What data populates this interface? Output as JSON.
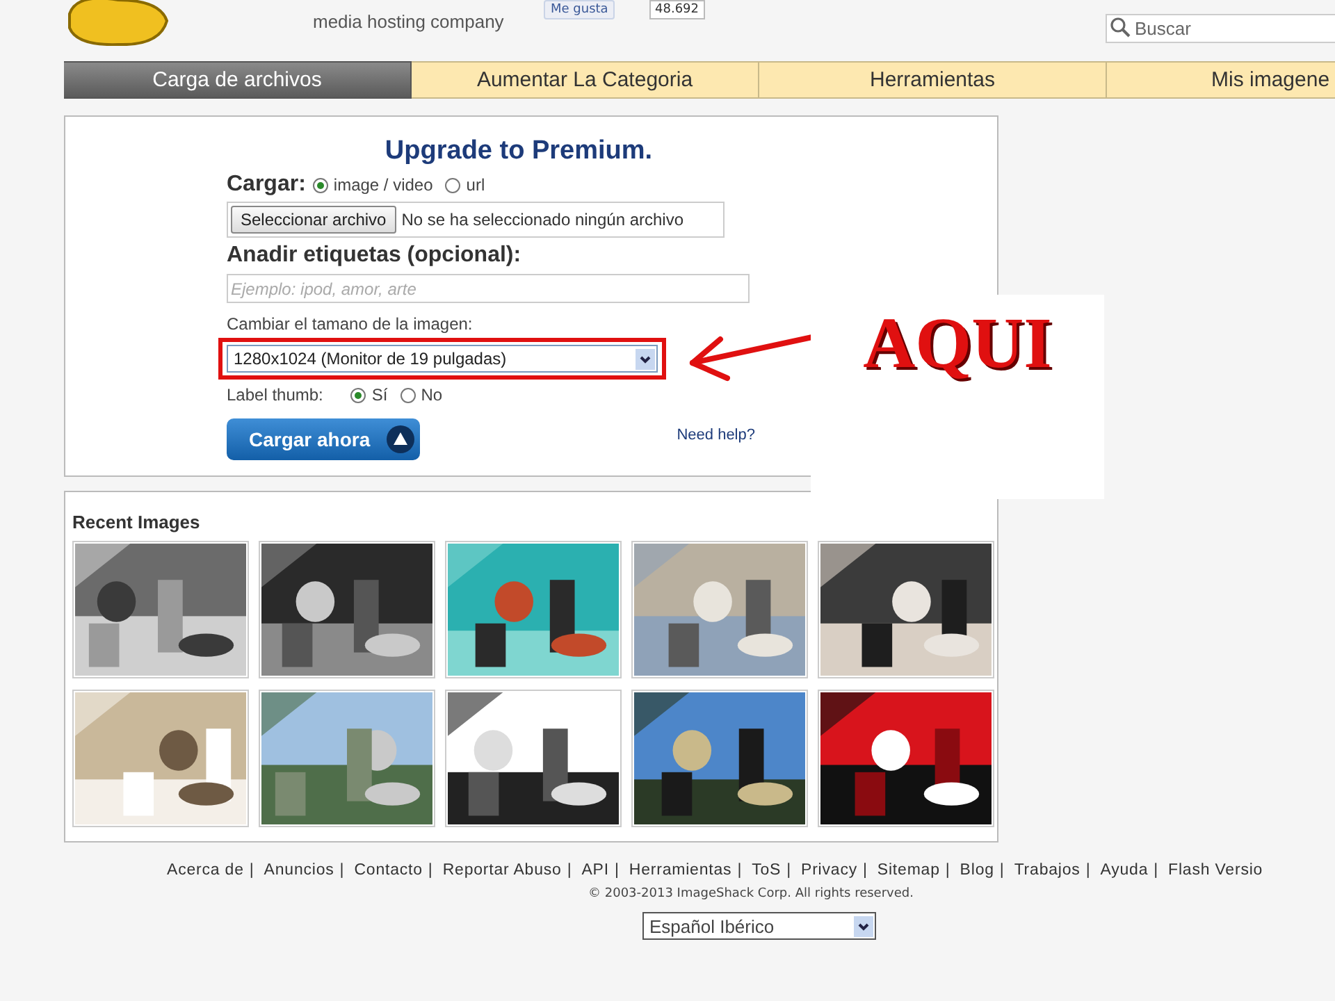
{
  "header": {
    "tagline": "media hosting company",
    "like_button": "Me gusta",
    "like_count": "48.692",
    "search": {
      "placeholder": "Buscar"
    }
  },
  "tabs": [
    {
      "label": "Carga de archivos",
      "selected": true
    },
    {
      "label": "Aumentar La Categoria",
      "selected": false
    },
    {
      "label": "Herramientas",
      "selected": false
    },
    {
      "label": "Mis imagene",
      "selected": false
    }
  ],
  "upload_form": {
    "title": "Upgrade to Premium.",
    "source_label": "Cargar:",
    "source_options": [
      {
        "label": "image / video",
        "selected": true
      },
      {
        "label": "url",
        "selected": false
      }
    ],
    "file_button": "Seleccionar archivo",
    "file_status": "No se ha seleccionado ningún archivo",
    "tags_label": "Anadir etiquetas (opcional):",
    "tags_placeholder": "Ejemplo: ipod, amor, arte",
    "resize_label": "Cambiar el tamano de la imagen:",
    "resize_value": "1280x1024 (Monitor de 19 pulgadas)",
    "thumb_label": "Label thumb:",
    "thumb_options": [
      {
        "label": "Sí",
        "selected": true
      },
      {
        "label": "No",
        "selected": false
      }
    ],
    "submit_button": "Cargar ahora",
    "help_link": "Need help?"
  },
  "annotation": {
    "text": "AQUI"
  },
  "recent_images": {
    "title": "Recent Images"
  },
  "footer": {
    "links": [
      "Acerca de",
      "Anuncios",
      "Contacto",
      "Reportar Abuso",
      "API",
      "Herramientas",
      "ToS",
      "Privacy",
      "Sitemap",
      "Blog",
      "Trabajos",
      "Ayuda",
      "Flash Versio"
    ],
    "separator": "|",
    "copyright": "© 2003-2013 ImageShack Corp. All rights reserved.",
    "language": "Español Ibérico"
  }
}
